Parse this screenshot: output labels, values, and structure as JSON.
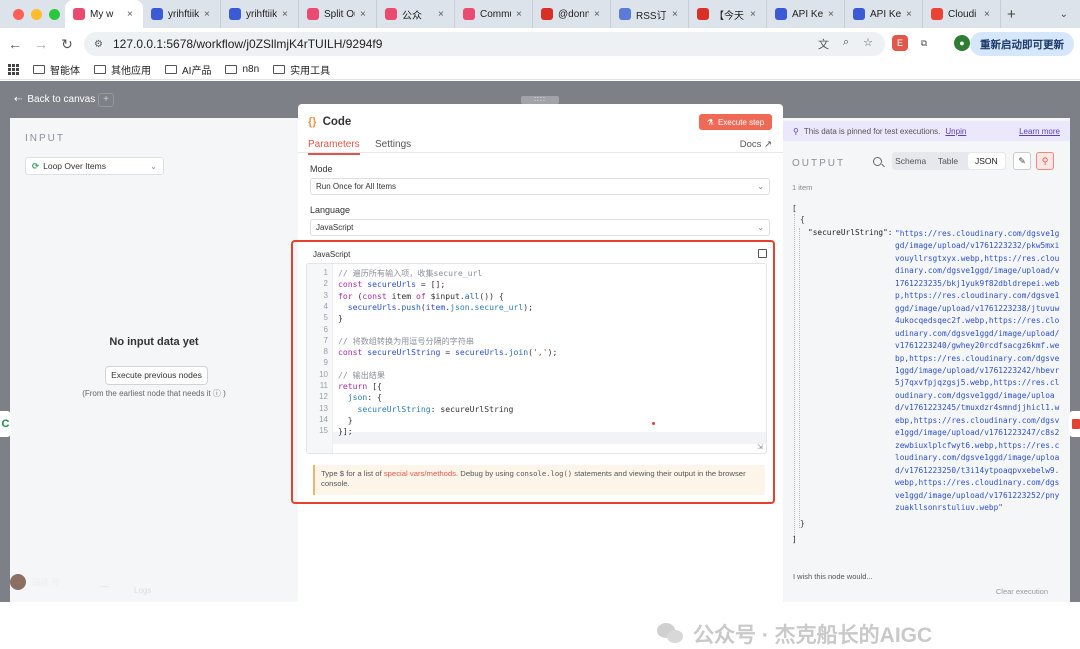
{
  "browser": {
    "tabs": [
      {
        "label": "My w",
        "active": true,
        "icon": "n8n-icon",
        "color": "#ea4b71"
      },
      {
        "label": "yrihftiik",
        "icon": "doc-icon",
        "color": "#3b5bd6"
      },
      {
        "label": "yrihftiik",
        "icon": "doc-icon",
        "color": "#3b5bd6"
      },
      {
        "label": "Split Ou",
        "icon": "n8n-icon",
        "color": "#ea4b71"
      },
      {
        "label": "公众",
        "icon": "n8n-icon",
        "color": "#ea4b71"
      },
      {
        "label": "Commu",
        "icon": "n8n-icon",
        "color": "#ea4b71"
      },
      {
        "label": "@donn",
        "icon": "square-icon",
        "color": "#d93025"
      },
      {
        "label": "RSS订",
        "icon": "rss-icon",
        "color": "#5b7bd6"
      },
      {
        "label": "【今天",
        "icon": "app-icon",
        "color": "#d93025"
      },
      {
        "label": "API Key",
        "icon": "doc-icon",
        "color": "#3b5bd6"
      },
      {
        "label": "API Key",
        "icon": "doc-icon",
        "color": "#3b5bd6"
      },
      {
        "label": "Cloudi",
        "icon": "gmail-icon",
        "color": "#ea4335"
      }
    ],
    "url": "127.0.0.1:5678/workflow/j0ZSllmjK4rTUILH/9294f9",
    "restart_label": "重新启动即可更新",
    "bookmarks": [
      "智能体",
      "其他应用",
      "AI产品",
      "n8n",
      "实用工具"
    ]
  },
  "canvas": {
    "back_label": "Back to canvas",
    "drag_handle": "::::",
    "user_name": "瑞建 孙",
    "logs_label": "Logs"
  },
  "input": {
    "title": "INPUT",
    "node_select": "Loop Over Items",
    "empty_title": "No input data yet",
    "exec_prev_label": "Execute previous nodes",
    "hint": "(From the earliest node that needs it ⓘ )"
  },
  "node": {
    "title": "Code",
    "execute_label": "Execute step",
    "tabs": [
      "Parameters",
      "Settings"
    ],
    "docs_label": "Docs",
    "mode_label": "Mode",
    "mode_value": "Run Once for All Items",
    "language_label": "Language",
    "language_value": "JavaScript",
    "editor_label": "JavaScript",
    "line_numbers": [
      "1",
      "2",
      "3",
      "4",
      "5",
      "6",
      "7",
      "8",
      "9",
      "10",
      "11",
      "12",
      "13",
      "14",
      "15"
    ],
    "code_lines": [
      "// 遍历所有输入项，收集secure_url",
      "const secureUrls = [];",
      "for (const item of $input.all()) {",
      "  secureUrls.push(item.json.secure_url);",
      "}",
      "",
      "// 将数组转换为用逗号分隔的字符串",
      "const secureUrlString = secureUrls.join(',');",
      "",
      "// 输出结果",
      "return [{",
      "  json: {",
      "    secureUrlString: secureUrlString",
      "  }",
      "}];"
    ],
    "tip_prefix": "Type $ for a list of ",
    "tip_link": "special vars/methods",
    "tip_mid": ". Debug by using ",
    "tip_code": "console.log()",
    "tip_suffix": " statements and viewing their output in the browser console."
  },
  "output": {
    "pinned_text": "This data is pinned for test executions.",
    "unpin_label": "Unpin",
    "learn_more": "Learn more",
    "title": "OUTPUT",
    "views": [
      "Schema",
      "Table",
      "JSON"
    ],
    "selected_view": "JSON",
    "item_count": "1 item",
    "json_open": "[",
    "json_obj_open": "{",
    "json_key": "\"secureUrlString\":",
    "json_value": "\"https://res.cloudinary.com/dgsve1ggd/image/upload/v1761223232/pkw5mxivouyllrsgtxyx.webp,https://res.cloudinary.com/dgsve1ggd/image/upload/v1761223235/bkj1yuk9f82dbldrepei.webp,https://res.cloudinary.com/dgsve1ggd/image/upload/v1761223238/jtuvuw4ukocqedsqec2f.webp,https://res.cloudinary.com/dgsve1ggd/image/upload/v1761223240/gwhey20rcdfsacgz6kmf.webp,https://res.cloudinary.com/dgsve1ggd/image/upload/v1761223242/hbevr5j7qxvfpjqzgsj5.webp,https://res.cloudinary.com/dgsve1ggd/image/upload/v1761223245/tmuxdzr4smndjjhicl1.webp,https://res.cloudinary.com/dgsve1ggd/image/upload/v1761223247/c8s2zewbiuxlplcfwyt6.webp,https://res.cloudinary.com/dgsve1ggd/image/upload/v1761223250/t3i14ytpoaqpvxebelw9.webp,https://res.cloudinary.com/dgsve1ggd/image/upload/v1761223252/pnyzuakllsonrstuliuv.webp\"",
    "json_obj_close": "}",
    "json_close": "]",
    "feedback": "I wish this node would...",
    "clear_label": "Clear execution"
  },
  "watermark": "公众号 · 杰克船长的AIGC",
  "colors": {
    "accent": "#ee6a57",
    "highlight_border": "#e44133",
    "json_string": "#2d50c8"
  }
}
